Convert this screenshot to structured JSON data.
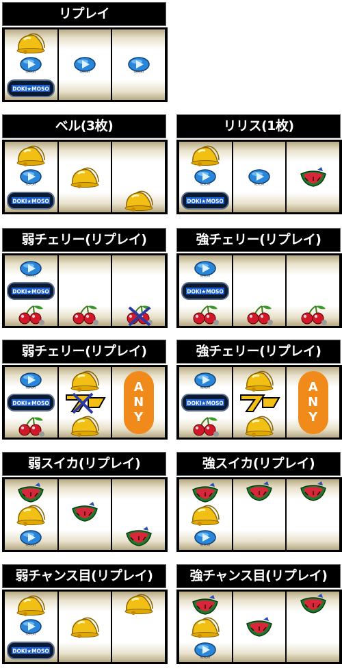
{
  "panels": [
    {
      "title": "リプレイ",
      "reels": [
        [
          "bell",
          "replay",
          "logo"
        ],
        [
          "replay"
        ],
        [
          "replay"
        ]
      ]
    },
    {
      "title": "ベル(3枚)",
      "reels": [
        [
          "bell",
          "replay",
          "logo"
        ],
        [
          "bell"
        ],
        [
          "bell"
        ]
      ]
    },
    {
      "title": "リリス(1枚)",
      "reels": [
        [
          "bell",
          "replay",
          "logo"
        ],
        [
          "replay"
        ],
        [
          "watermelon"
        ]
      ]
    },
    {
      "title": "弱チェリー(リプレイ)",
      "reels": [
        [
          "replay",
          "logo",
          "cherry"
        ],
        [
          "cherry"
        ],
        [
          "cherry-crossed"
        ]
      ]
    },
    {
      "title": "強チェリー(リプレイ)",
      "reels": [
        [
          "replay",
          "logo",
          "cherry"
        ],
        [
          "cherry"
        ],
        [
          "cherry"
        ]
      ]
    },
    {
      "title": "弱チェリー(リプレイ)",
      "reels": [
        [
          "replay",
          "logo",
          "cherry"
        ],
        [
          "bell",
          "seven-crossed",
          "bell"
        ],
        [
          "any"
        ]
      ]
    },
    {
      "title": "強チェリー(リプレイ)",
      "reels": [
        [
          "replay",
          "logo",
          "cherry"
        ],
        [
          "bell",
          "seven",
          "bell"
        ],
        [
          "any"
        ]
      ]
    },
    {
      "title": "弱スイカ(リプレイ)",
      "reels": [
        [
          "watermelon",
          "bell",
          "replay"
        ],
        [
          "watermelon"
        ],
        [
          "watermelon"
        ]
      ]
    },
    {
      "title": "強スイカ(リプレイ)",
      "reels": [
        [
          "watermelon",
          "bell",
          "replay"
        ],
        [
          "watermelon"
        ],
        [
          "watermelon"
        ]
      ]
    },
    {
      "title": "弱チャンス目(リプレイ)",
      "reels": [
        [
          "bell",
          "replay",
          "logo"
        ],
        [
          "bell"
        ],
        [
          "bell"
        ]
      ]
    },
    {
      "title": "強チャンス目(リプレイ)",
      "reels": [
        [
          "watermelon",
          "bell",
          "replay"
        ],
        [
          "watermelon"
        ],
        [
          "watermelon"
        ]
      ]
    }
  ],
  "replay_caption": "REPLAY",
  "logo_text": "DOKI★MOSO",
  "any_text": [
    "A",
    "N",
    "Y"
  ],
  "colors": {
    "bell": "#f2c014",
    "replay": "#2a86d8",
    "watermelon_rind": "#1c7a2a",
    "watermelon_flesh": "#d8263a",
    "cherry": "#d01828",
    "any": "#f08a1a",
    "seven": "#f2c014"
  }
}
